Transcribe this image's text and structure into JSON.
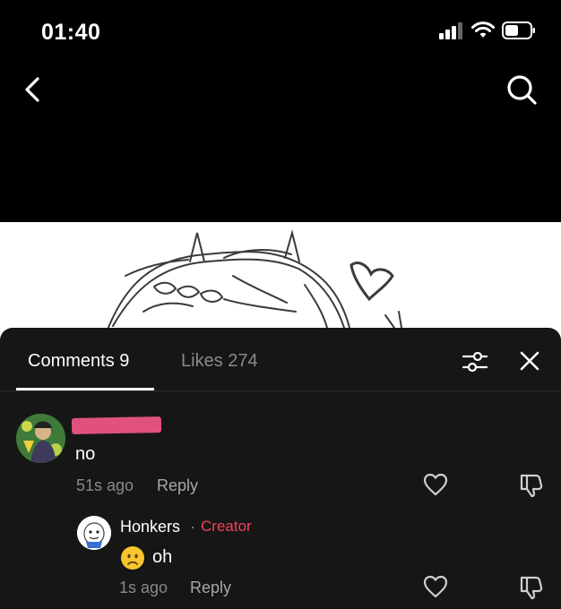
{
  "status_bar": {
    "time": "01:40",
    "icons": [
      "cellular-signal-icon",
      "wifi-icon",
      "battery-icon"
    ]
  },
  "nav": {
    "back_icon": "chevron-left-icon",
    "search_icon": "search-icon"
  },
  "comments_sheet": {
    "tabs": [
      {
        "label": "Comments 9",
        "active": true
      },
      {
        "label": "Likes 274",
        "active": false
      }
    ],
    "filter_icon": "sliders-icon",
    "close_icon": "close-icon",
    "comments": [
      {
        "text": "no",
        "time": "51s ago",
        "reply_label": "Reply"
      }
    ],
    "replies": [
      {
        "author": "Honkers",
        "separator": "·",
        "badge": "Creator",
        "text": "oh",
        "time": "1s ago",
        "reply_label": "Reply"
      }
    ]
  },
  "colors": {
    "background": "#000000",
    "sheet": "#161616",
    "creator_badge": "#f2425e",
    "redaction": "#e0527c",
    "muted_text": "#8a8a8a"
  }
}
